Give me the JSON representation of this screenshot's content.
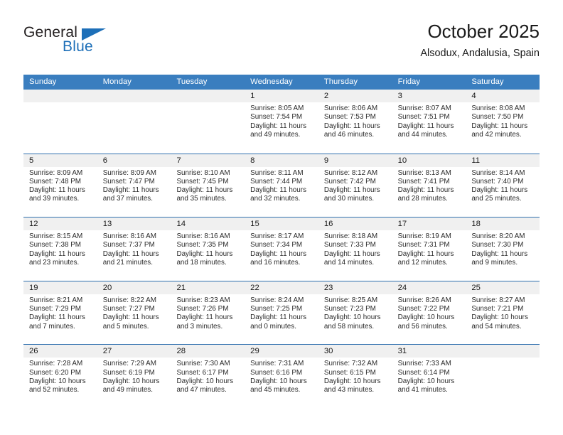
{
  "brand": {
    "name_part1": "General",
    "name_part2": "Blue",
    "accent_color": "#1d6fb8"
  },
  "header": {
    "title": "October 2025",
    "subtitle": "Alsodux, Andalusia, Spain"
  },
  "calendar": {
    "header_bg": "#3a7ebf",
    "day_band_bg": "#f0f0f0",
    "weekdays": [
      "Sunday",
      "Monday",
      "Tuesday",
      "Wednesday",
      "Thursday",
      "Friday",
      "Saturday"
    ],
    "weeks": [
      [
        {
          "day": "",
          "sunrise": "",
          "sunset": "",
          "daylight_line1": "",
          "daylight_line2": ""
        },
        {
          "day": "",
          "sunrise": "",
          "sunset": "",
          "daylight_line1": "",
          "daylight_line2": ""
        },
        {
          "day": "",
          "sunrise": "",
          "sunset": "",
          "daylight_line1": "",
          "daylight_line2": ""
        },
        {
          "day": "1",
          "sunrise": "Sunrise: 8:05 AM",
          "sunset": "Sunset: 7:54 PM",
          "daylight_line1": "Daylight: 11 hours",
          "daylight_line2": "and 49 minutes."
        },
        {
          "day": "2",
          "sunrise": "Sunrise: 8:06 AM",
          "sunset": "Sunset: 7:53 PM",
          "daylight_line1": "Daylight: 11 hours",
          "daylight_line2": "and 46 minutes."
        },
        {
          "day": "3",
          "sunrise": "Sunrise: 8:07 AM",
          "sunset": "Sunset: 7:51 PM",
          "daylight_line1": "Daylight: 11 hours",
          "daylight_line2": "and 44 minutes."
        },
        {
          "day": "4",
          "sunrise": "Sunrise: 8:08 AM",
          "sunset": "Sunset: 7:50 PM",
          "daylight_line1": "Daylight: 11 hours",
          "daylight_line2": "and 42 minutes."
        }
      ],
      [
        {
          "day": "5",
          "sunrise": "Sunrise: 8:09 AM",
          "sunset": "Sunset: 7:48 PM",
          "daylight_line1": "Daylight: 11 hours",
          "daylight_line2": "and 39 minutes."
        },
        {
          "day": "6",
          "sunrise": "Sunrise: 8:09 AM",
          "sunset": "Sunset: 7:47 PM",
          "daylight_line1": "Daylight: 11 hours",
          "daylight_line2": "and 37 minutes."
        },
        {
          "day": "7",
          "sunrise": "Sunrise: 8:10 AM",
          "sunset": "Sunset: 7:45 PM",
          "daylight_line1": "Daylight: 11 hours",
          "daylight_line2": "and 35 minutes."
        },
        {
          "day": "8",
          "sunrise": "Sunrise: 8:11 AM",
          "sunset": "Sunset: 7:44 PM",
          "daylight_line1": "Daylight: 11 hours",
          "daylight_line2": "and 32 minutes."
        },
        {
          "day": "9",
          "sunrise": "Sunrise: 8:12 AM",
          "sunset": "Sunset: 7:42 PM",
          "daylight_line1": "Daylight: 11 hours",
          "daylight_line2": "and 30 minutes."
        },
        {
          "day": "10",
          "sunrise": "Sunrise: 8:13 AM",
          "sunset": "Sunset: 7:41 PM",
          "daylight_line1": "Daylight: 11 hours",
          "daylight_line2": "and 28 minutes."
        },
        {
          "day": "11",
          "sunrise": "Sunrise: 8:14 AM",
          "sunset": "Sunset: 7:40 PM",
          "daylight_line1": "Daylight: 11 hours",
          "daylight_line2": "and 25 minutes."
        }
      ],
      [
        {
          "day": "12",
          "sunrise": "Sunrise: 8:15 AM",
          "sunset": "Sunset: 7:38 PM",
          "daylight_line1": "Daylight: 11 hours",
          "daylight_line2": "and 23 minutes."
        },
        {
          "day": "13",
          "sunrise": "Sunrise: 8:16 AM",
          "sunset": "Sunset: 7:37 PM",
          "daylight_line1": "Daylight: 11 hours",
          "daylight_line2": "and 21 minutes."
        },
        {
          "day": "14",
          "sunrise": "Sunrise: 8:16 AM",
          "sunset": "Sunset: 7:35 PM",
          "daylight_line1": "Daylight: 11 hours",
          "daylight_line2": "and 18 minutes."
        },
        {
          "day": "15",
          "sunrise": "Sunrise: 8:17 AM",
          "sunset": "Sunset: 7:34 PM",
          "daylight_line1": "Daylight: 11 hours",
          "daylight_line2": "and 16 minutes."
        },
        {
          "day": "16",
          "sunrise": "Sunrise: 8:18 AM",
          "sunset": "Sunset: 7:33 PM",
          "daylight_line1": "Daylight: 11 hours",
          "daylight_line2": "and 14 minutes."
        },
        {
          "day": "17",
          "sunrise": "Sunrise: 8:19 AM",
          "sunset": "Sunset: 7:31 PM",
          "daylight_line1": "Daylight: 11 hours",
          "daylight_line2": "and 12 minutes."
        },
        {
          "day": "18",
          "sunrise": "Sunrise: 8:20 AM",
          "sunset": "Sunset: 7:30 PM",
          "daylight_line1": "Daylight: 11 hours",
          "daylight_line2": "and 9 minutes."
        }
      ],
      [
        {
          "day": "19",
          "sunrise": "Sunrise: 8:21 AM",
          "sunset": "Sunset: 7:29 PM",
          "daylight_line1": "Daylight: 11 hours",
          "daylight_line2": "and 7 minutes."
        },
        {
          "day": "20",
          "sunrise": "Sunrise: 8:22 AM",
          "sunset": "Sunset: 7:27 PM",
          "daylight_line1": "Daylight: 11 hours",
          "daylight_line2": "and 5 minutes."
        },
        {
          "day": "21",
          "sunrise": "Sunrise: 8:23 AM",
          "sunset": "Sunset: 7:26 PM",
          "daylight_line1": "Daylight: 11 hours",
          "daylight_line2": "and 3 minutes."
        },
        {
          "day": "22",
          "sunrise": "Sunrise: 8:24 AM",
          "sunset": "Sunset: 7:25 PM",
          "daylight_line1": "Daylight: 11 hours",
          "daylight_line2": "and 0 minutes."
        },
        {
          "day": "23",
          "sunrise": "Sunrise: 8:25 AM",
          "sunset": "Sunset: 7:23 PM",
          "daylight_line1": "Daylight: 10 hours",
          "daylight_line2": "and 58 minutes."
        },
        {
          "day": "24",
          "sunrise": "Sunrise: 8:26 AM",
          "sunset": "Sunset: 7:22 PM",
          "daylight_line1": "Daylight: 10 hours",
          "daylight_line2": "and 56 minutes."
        },
        {
          "day": "25",
          "sunrise": "Sunrise: 8:27 AM",
          "sunset": "Sunset: 7:21 PM",
          "daylight_line1": "Daylight: 10 hours",
          "daylight_line2": "and 54 minutes."
        }
      ],
      [
        {
          "day": "26",
          "sunrise": "Sunrise: 7:28 AM",
          "sunset": "Sunset: 6:20 PM",
          "daylight_line1": "Daylight: 10 hours",
          "daylight_line2": "and 52 minutes."
        },
        {
          "day": "27",
          "sunrise": "Sunrise: 7:29 AM",
          "sunset": "Sunset: 6:19 PM",
          "daylight_line1": "Daylight: 10 hours",
          "daylight_line2": "and 49 minutes."
        },
        {
          "day": "28",
          "sunrise": "Sunrise: 7:30 AM",
          "sunset": "Sunset: 6:17 PM",
          "daylight_line1": "Daylight: 10 hours",
          "daylight_line2": "and 47 minutes."
        },
        {
          "day": "29",
          "sunrise": "Sunrise: 7:31 AM",
          "sunset": "Sunset: 6:16 PM",
          "daylight_line1": "Daylight: 10 hours",
          "daylight_line2": "and 45 minutes."
        },
        {
          "day": "30",
          "sunrise": "Sunrise: 7:32 AM",
          "sunset": "Sunset: 6:15 PM",
          "daylight_line1": "Daylight: 10 hours",
          "daylight_line2": "and 43 minutes."
        },
        {
          "day": "31",
          "sunrise": "Sunrise: 7:33 AM",
          "sunset": "Sunset: 6:14 PM",
          "daylight_line1": "Daylight: 10 hours",
          "daylight_line2": "and 41 minutes."
        },
        {
          "day": "",
          "sunrise": "",
          "sunset": "",
          "daylight_line1": "",
          "daylight_line2": ""
        }
      ]
    ]
  }
}
